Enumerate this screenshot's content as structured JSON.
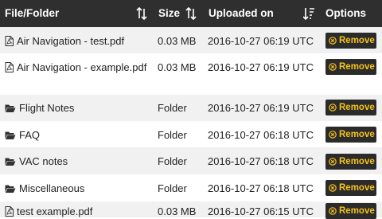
{
  "table": {
    "headers": {
      "name": "File/Folder",
      "size": "Size",
      "uploaded": "Uploaded on",
      "options": "Options"
    },
    "rows": [
      {
        "name": "Air Navigation - test.pdf",
        "size": "0.03 MB",
        "uploaded": "2016-10-27 06:19 UTC",
        "icon": "file-pdf-icon",
        "action": "Remove"
      },
      {
        "name": "Air Navigation - example.pdf",
        "size": "0.03 MB",
        "uploaded": "2016-10-27 06:19 UTC",
        "icon": "file-pdf-icon",
        "action": "Remove"
      },
      {
        "name": "Flight Notes",
        "size": "Folder",
        "uploaded": "2016-10-27 06:19 UTC",
        "icon": "folder-open-icon",
        "action": "Remove"
      },
      {
        "name": "FAQ",
        "size": "Folder",
        "uploaded": "2016-10-27 06:18 UTC",
        "icon": "folder-open-icon",
        "action": "Remove"
      },
      {
        "name": "VAC notes",
        "size": "Folder",
        "uploaded": "2016-10-27 06:18 UTC",
        "icon": "folder-open-icon",
        "action": "Remove"
      },
      {
        "name": "Miscellaneous",
        "size": "Folder",
        "uploaded": "2016-10-27 06:18 UTC",
        "icon": "folder-open-icon",
        "action": "Remove"
      },
      {
        "name": "test example.pdf",
        "size": "0.03 MB",
        "uploaded": "2016-10-27 06:15 UTC",
        "icon": "file-pdf-icon",
        "action": "Remove"
      }
    ]
  },
  "colors": {
    "header_bg": "#2f2f2f",
    "header_text": "#ffffff",
    "row_alt_bg": "#f1f1f1",
    "button_bg": "#2b2b2b",
    "button_text": "#f7c31c"
  }
}
